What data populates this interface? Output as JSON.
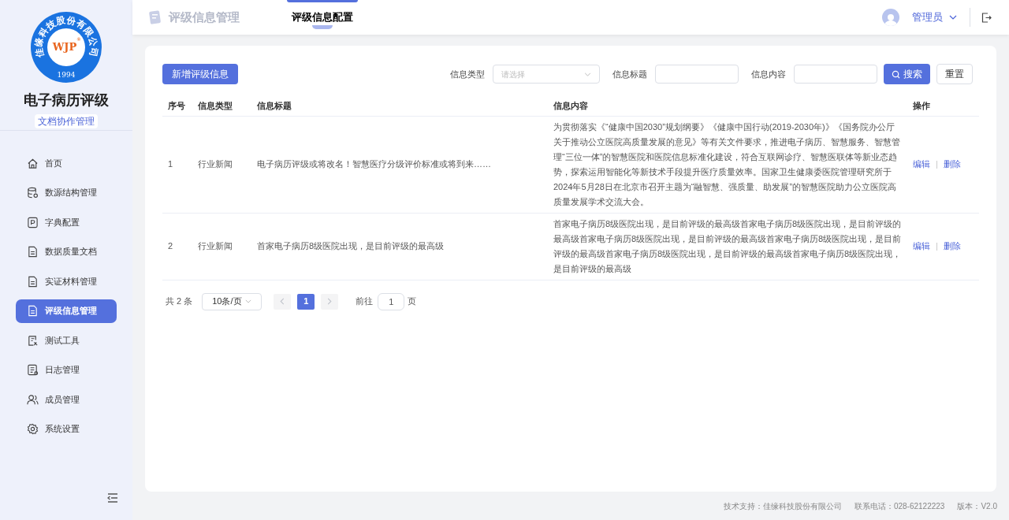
{
  "logo": {
    "ring_text": "佳缘科技股份有限公司",
    "center_text": "WJP",
    "registered_mark": "®",
    "year": "1994"
  },
  "app": {
    "title": "电子病历评级",
    "subtitle": "文档协作管理"
  },
  "sidebar": {
    "items": [
      {
        "label": "首页",
        "selected": false
      },
      {
        "label": "数源结构管理",
        "selected": false
      },
      {
        "label": "字典配置",
        "selected": false
      },
      {
        "label": "数据质量文档",
        "selected": false
      },
      {
        "label": "实证材料管理",
        "selected": false
      },
      {
        "label": "评级信息管理",
        "selected": true
      },
      {
        "label": "测试工具",
        "selected": false
      },
      {
        "label": "日志管理",
        "selected": false
      },
      {
        "label": "成员管理",
        "selected": false
      },
      {
        "label": "系统设置",
        "selected": false
      }
    ]
  },
  "header": {
    "page_title": "评级信息管理",
    "tabs": [
      {
        "label": "评级信息配置",
        "selected": true
      }
    ],
    "user": "管理员"
  },
  "toolbar": {
    "add_button": "新增评级信息",
    "filters": [
      {
        "label": "信息类型",
        "kind": "select",
        "placeholder": "请选择"
      },
      {
        "label": "信息标题",
        "kind": "input"
      },
      {
        "label": "信息内容",
        "kind": "input"
      }
    ],
    "search_button": "搜索",
    "reset_button": "重置"
  },
  "table": {
    "columns": [
      "序号",
      "信息类型",
      "信息标题",
      "信息内容",
      "操作"
    ],
    "rows": [
      {
        "index": "1",
        "type": "行业新闻",
        "title": "电子病历评级或将改名！智慧医疗分级评价标准或将到来……",
        "content": "为贯彻落实《“健康中国2030”规划纲要》《健康中国行动(2019-2030年)》《国务院办公厅关于推动公立医院高质量发展的意见》等有关文件要求，推进电子病历、智慧服务、智慧管理“三位一体”的智慧医院和医院信息标准化建设，符合互联网诊疗、智慧医联体等新业态趋势，探索运用智能化等新技术手段提升医疗质量效率。国家卫生健康委医院管理研究所于2024年5月28日在北京市召开主题为“融智慧、强质量、助发展”的智慧医院助力公立医院高质量发展学术交流大会。",
        "actions": [
          "编辑",
          "删除"
        ]
      },
      {
        "index": "2",
        "type": "行业新闻",
        "title": "首家电子病历8级医院出现，是目前评级的最高级",
        "content": "首家电子病历8级医院出现，是目前评级的最高级首家电子病历8级医院出现，是目前评级的最高级首家电子病历8级医院出现，是目前评级的最高级首家电子病历8级医院出现，是目前评级的最高级首家电子病历8级医院出现，是目前评级的最高级首家电子病历8级医院出现，是目前评级的最高级",
        "actions": [
          "编辑",
          "删除"
        ]
      }
    ]
  },
  "pagination": {
    "total": "共 2 条",
    "page_size": "10条/页",
    "pages": [
      {
        "label": "1",
        "selected": true
      }
    ],
    "goto_label": "前往",
    "goto_value": "1",
    "goto_suffix": "页"
  },
  "footer": [
    "技术支持：佳缘科技股份有限公司",
    "联系电话：028-62122223",
    "版本：V2.0"
  ]
}
